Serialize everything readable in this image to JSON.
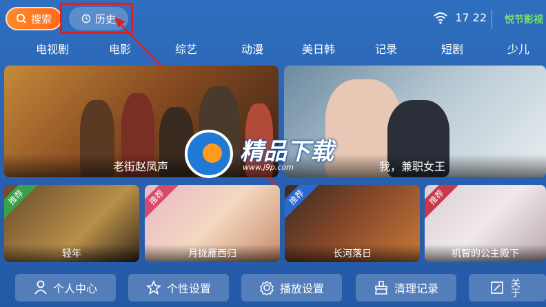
{
  "topbar": {
    "search_label": "搜索",
    "history_label": "历史",
    "time": "17 22",
    "brand": "悦节影视"
  },
  "nav": {
    "items": [
      "电视剧",
      "电影",
      "综艺",
      "动漫",
      "美日韩",
      "记录",
      "短剧",
      "少儿"
    ]
  },
  "banners": [
    {
      "title": "老街赵凤声"
    },
    {
      "title": "我，兼职女王"
    }
  ],
  "cards": [
    {
      "badge": "推荐",
      "title": "轻年"
    },
    {
      "badge": "推荐",
      "title": "月拢雁西归"
    },
    {
      "badge": "推荐",
      "title": "长河落日"
    },
    {
      "badge": "推荐",
      "title": "机智的公主殿下"
    }
  ],
  "bottom_buttons": [
    {
      "label": "个人中心",
      "icon": "user-icon"
    },
    {
      "label": "个性设置",
      "icon": "star-icon"
    },
    {
      "label": "播放设置",
      "icon": "gear-icon"
    },
    {
      "label": "清理记录",
      "icon": "broom-icon"
    },
    {
      "label": "关于",
      "icon": "info-icon"
    }
  ],
  "watermark": {
    "text": "精品下载",
    "url": "www.j9p.com"
  },
  "colors": {
    "accent": "#ff7a20",
    "annotation": "#e02020",
    "background": "#2a64b3"
  }
}
